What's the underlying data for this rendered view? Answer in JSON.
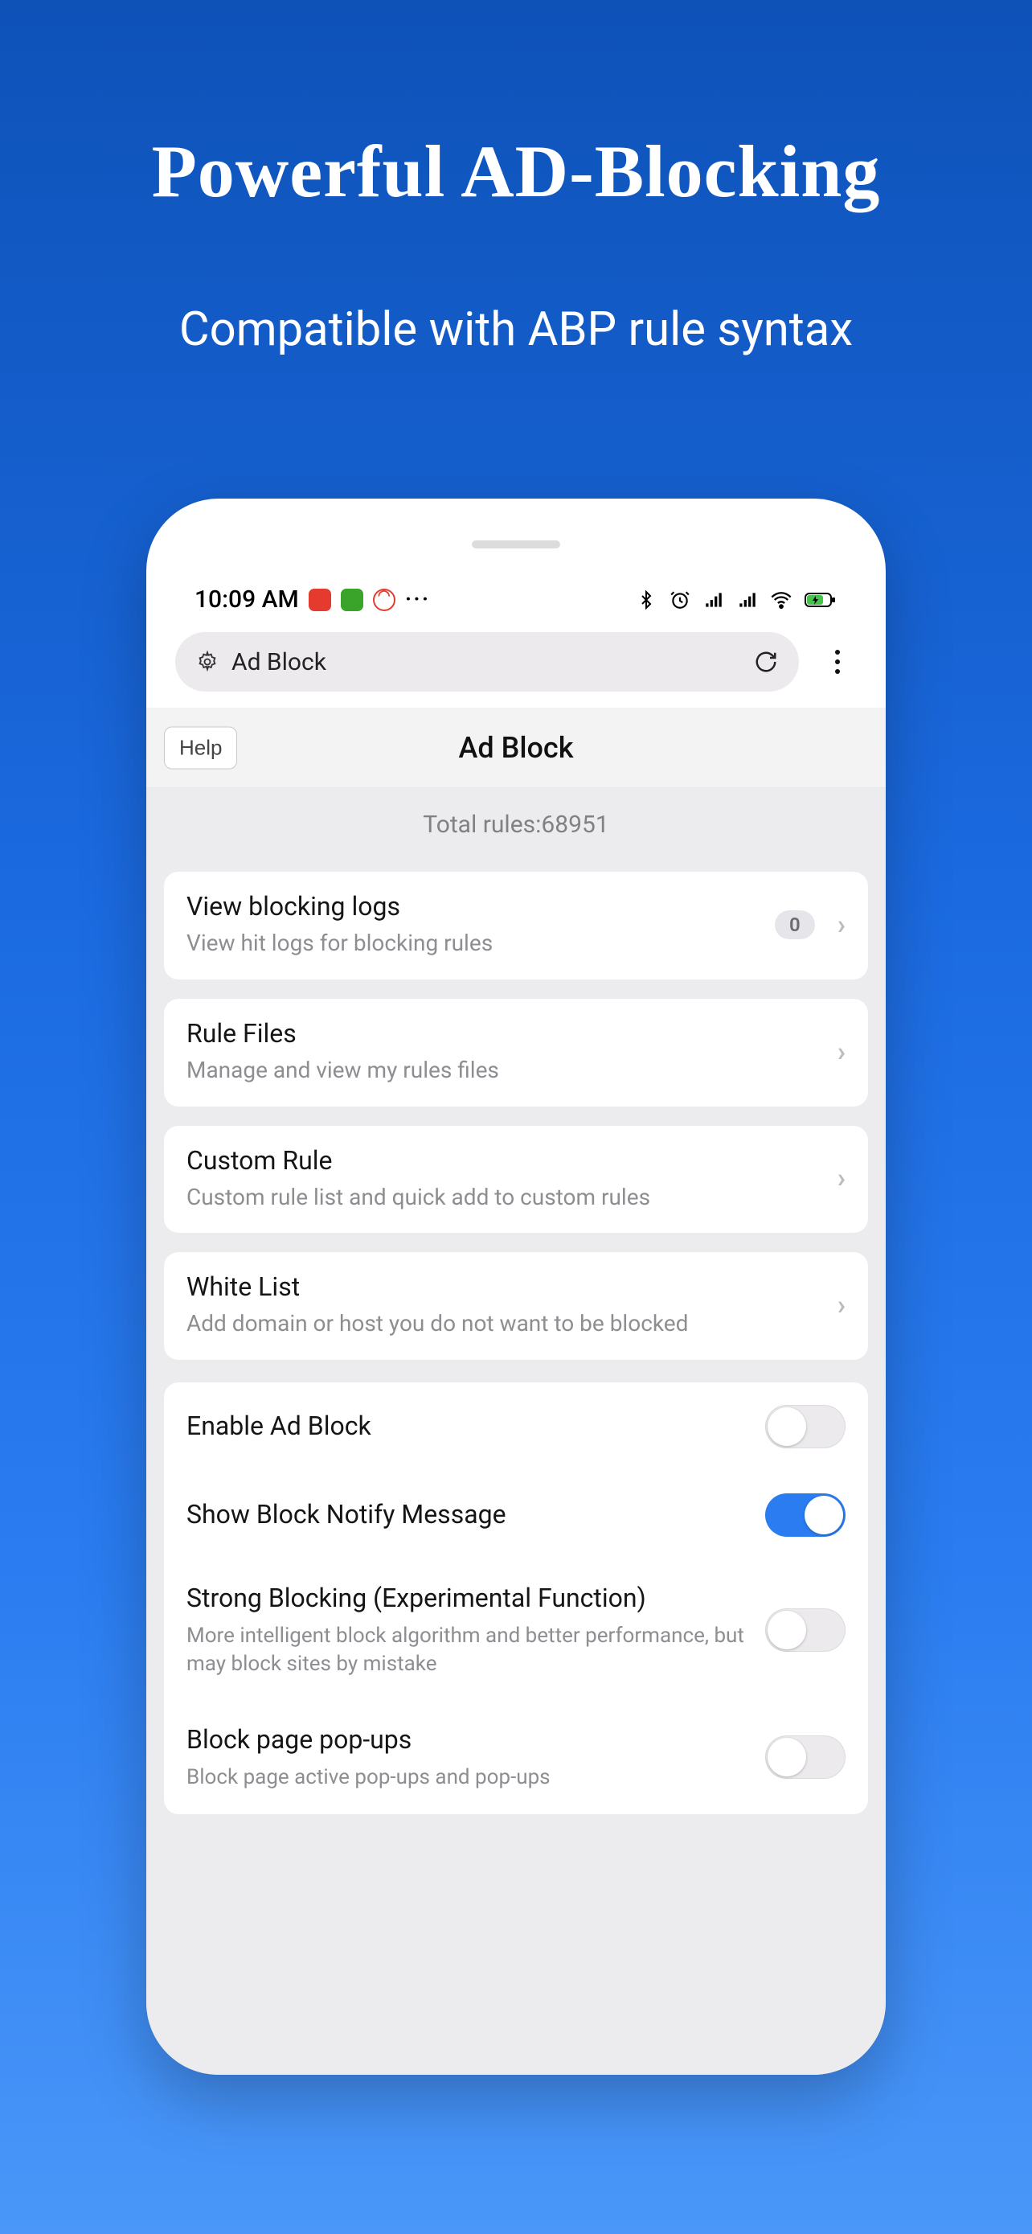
{
  "hero": {
    "title": "Powerful AD-Blocking",
    "subtitle": "Compatible with ABP rule syntax"
  },
  "statusbar": {
    "time": "10:09 AM",
    "ellipsis": "···"
  },
  "topbar": {
    "tab_label": "Ad Block"
  },
  "subheader": {
    "help_label": "Help",
    "title": "Ad Block"
  },
  "total": {
    "label_prefix": "Total rules: ",
    "count": "68951"
  },
  "items": [
    {
      "title": "View blocking logs",
      "sub": "View hit logs for blocking rules",
      "badge": "0"
    },
    {
      "title": "Rule Files",
      "sub": "Manage and view my rules files"
    },
    {
      "title": "Custom Rule",
      "sub": "Custom rule list and quick add to custom rules"
    },
    {
      "title": "White List",
      "sub": "Add domain or host you do not want to be blocked"
    }
  ],
  "switches": [
    {
      "title": "Enable Ad Block",
      "on": false
    },
    {
      "title": "Show Block Notify Message",
      "on": true
    },
    {
      "title": "Strong Blocking (Experimental Function)",
      "sub": "More intelligent block algorithm and better performance, but may block sites by mistake",
      "on": false
    },
    {
      "title": "Block page pop-ups",
      "sub": "Block page active pop-ups and pop-ups",
      "on": false
    }
  ]
}
